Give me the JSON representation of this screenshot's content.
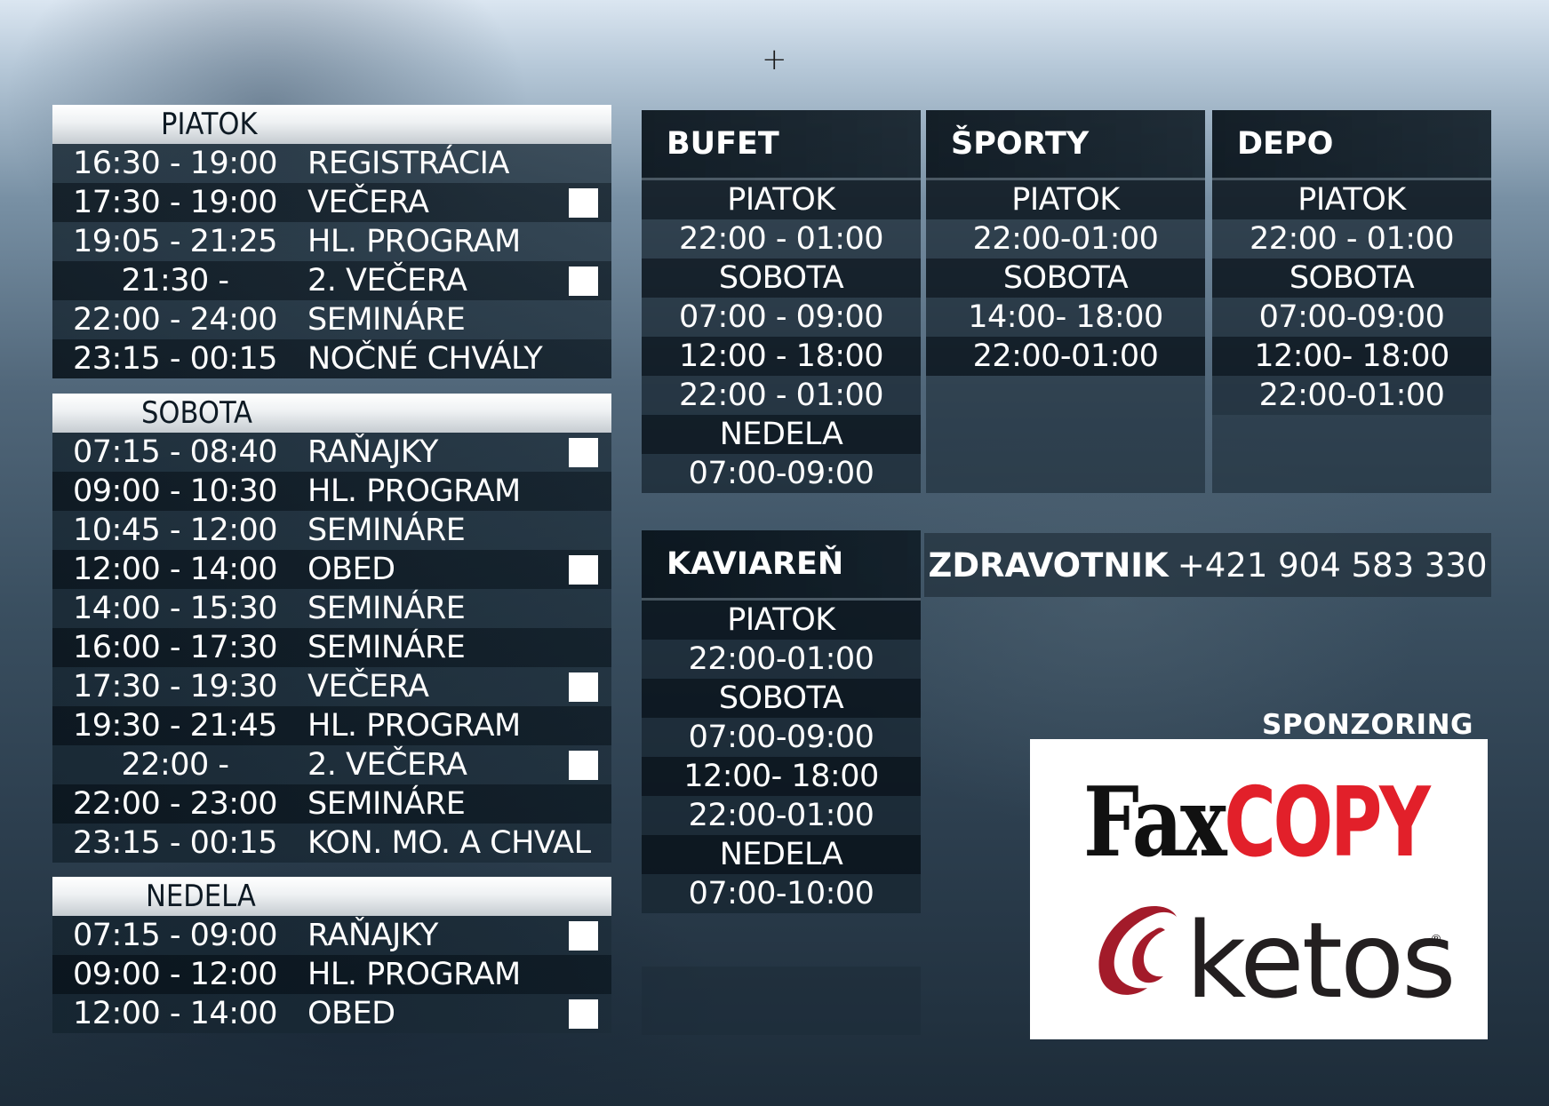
{
  "plus_symbol": "+",
  "schedule": {
    "piatok": {
      "title": "PIATOK",
      "rows": [
        {
          "time": "16:30 - 19:00",
          "activity": "REGISTRÁCIA"
        },
        {
          "time": "17:30 - 19:00",
          "activity": "VEČERA"
        },
        {
          "time": "19:05 - 21:25",
          "activity": "HL. PROGRAM"
        },
        {
          "time": "21:30 -",
          "activity": "2. VEČERA"
        },
        {
          "time": "22:00 - 24:00",
          "activity": "SEMINÁRE"
        },
        {
          "time": "23:15 - 00:15",
          "activity": "NOČNÉ CHVÁLY"
        }
      ]
    },
    "sobota": {
      "title": "SOBOTA",
      "rows": [
        {
          "time": "07:15 - 08:40",
          "activity": "RAŇAJKY"
        },
        {
          "time": "09:00 - 10:30",
          "activity": "HL. PROGRAM"
        },
        {
          "time": "10:45 - 12:00",
          "activity": "SEMINÁRE"
        },
        {
          "time": "12:00 - 14:00",
          "activity": "OBED"
        },
        {
          "time": "14:00 - 15:30",
          "activity": "SEMINÁRE"
        },
        {
          "time": "16:00 - 17:30",
          "activity": "SEMINÁRE"
        },
        {
          "time": "17:30 - 19:30",
          "activity": "VEČERA"
        },
        {
          "time": "19:30 - 21:45",
          "activity": "HL. PROGRAM"
        },
        {
          "time": "22:00 -",
          "activity": "2. VEČERA"
        },
        {
          "time": "22:00 - 23:00",
          "activity": "SEMINÁRE"
        },
        {
          "time": "23:15 - 00:15",
          "activity": "KON. MO. A CHVAL"
        }
      ]
    },
    "nedela": {
      "title": "NEDELA",
      "rows": [
        {
          "time": "07:15 - 09:00",
          "activity": "RAŇAJKY"
        },
        {
          "time": "09:00 - 12:00",
          "activity": "HL. PROGRAM"
        },
        {
          "time": "12:00 - 14:00",
          "activity": "OBED"
        }
      ]
    }
  },
  "bufet": {
    "title": "BUFET",
    "rows": [
      "PIATOK",
      "22:00 - 01:00",
      "SOBOTA",
      "07:00 - 09:00",
      "12:00 - 18:00",
      "22:00 - 01:00",
      "NEDELA",
      "07:00-09:00"
    ]
  },
  "sporty": {
    "title": "ŠPORTY",
    "rows": [
      "PIATOK",
      "22:00-01:00",
      "SOBOTA",
      "14:00- 18:00",
      "22:00-01:00",
      "",
      "",
      ""
    ]
  },
  "depo": {
    "title": "DEPO",
    "rows": [
      "PIATOK",
      "22:00 - 01:00",
      "SOBOTA",
      "07:00-09:00",
      "12:00- 18:00",
      "22:00-01:00",
      "",
      ""
    ]
  },
  "kaviaren": {
    "title": "KAVIAREŇ",
    "rows": [
      "PIATOK",
      "22:00-01:00",
      "SOBOTA",
      "07:00-09:00",
      "12:00- 18:00",
      "22:00-01:00",
      "NEDELA",
      "07:00-10:00"
    ]
  },
  "zdravotnik": {
    "label": "ZDRAVOTNIK",
    "phone": "+421 904 583 330"
  },
  "sponsoring": {
    "label": "SPONZORING",
    "faxcopy_fax": "Fax",
    "faxcopy_copy": "COPY",
    "ketos": "ketos",
    "ketos_reg": "®"
  },
  "colors": {
    "meal_marker": "#ffffff",
    "copy_red": "#e2202a"
  }
}
